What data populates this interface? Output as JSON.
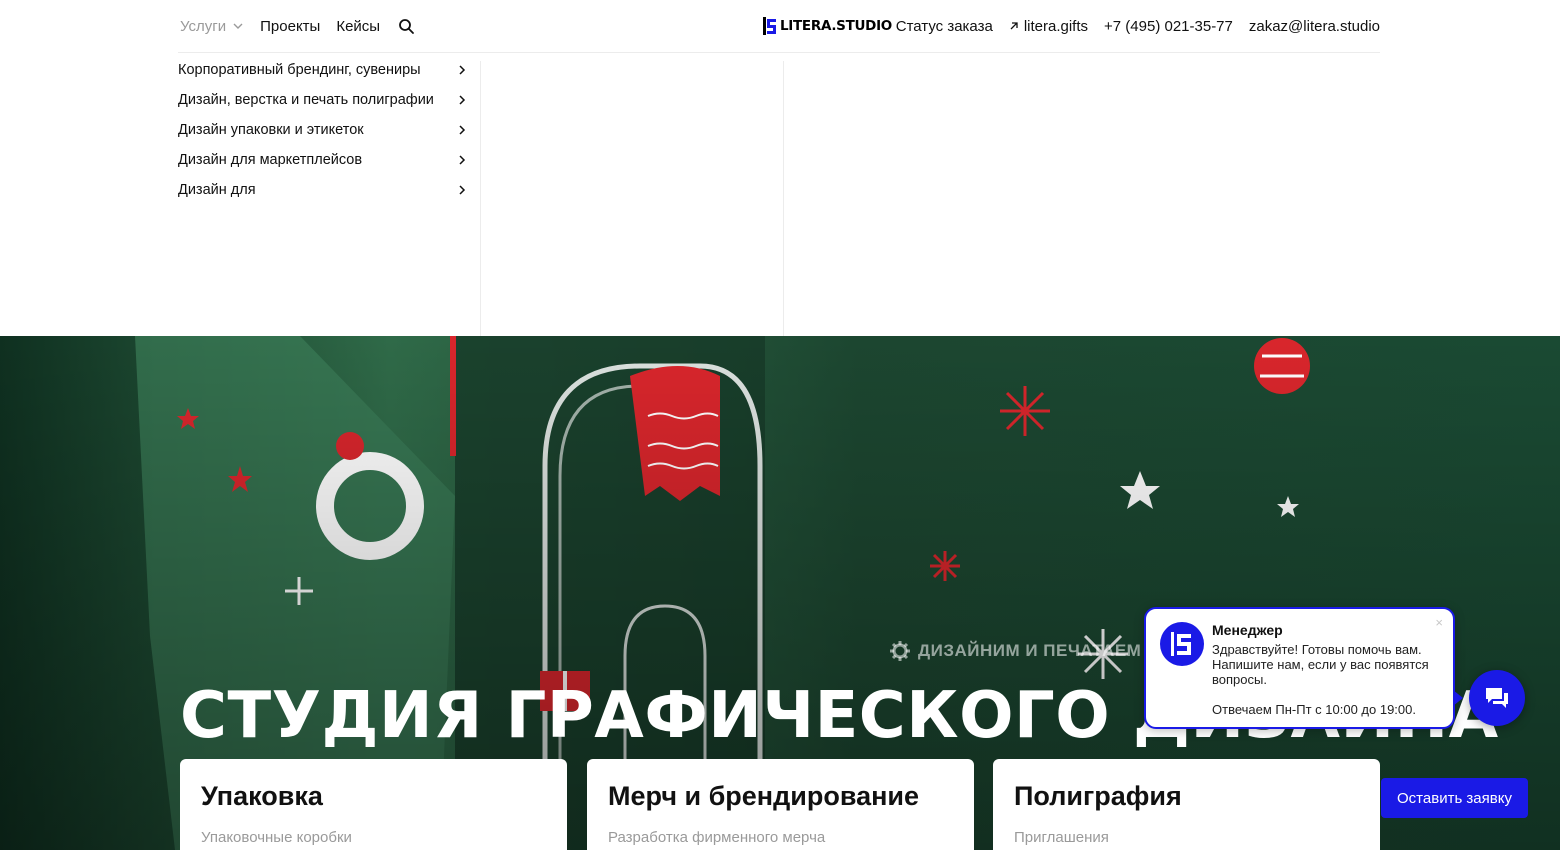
{
  "header": {
    "services_label": "Услуги",
    "projects_label": "Проекты",
    "cases_label": "Кейсы",
    "logo_text": "LITERA.STUDIO",
    "order_status_label": "Статус заказа",
    "gifts_link": "litera.gifts",
    "phone": "+7 (495) 021-35-77",
    "email": "zakaz@litera.studio"
  },
  "services_menu": {
    "items": [
      {
        "label": "Корпоративный брендинг, сувениры"
      },
      {
        "label": "Дизайн, верстка и печать полиграфии"
      },
      {
        "label": "Дизайн упаковки и этикеток"
      },
      {
        "label": "Дизайн для маркетплейсов"
      },
      {
        "label": "Дизайн для"
      }
    ]
  },
  "hero": {
    "tagline": "ДИЗАЙНИМ И ПЕЧАТАЕМ НА",
    "title": "СТУДИЯ ГРАФИЧЕСКОГО ДИЗАЙНА",
    "cards": [
      {
        "title": "Упаковка",
        "subtitle": "Упаковочные коробки"
      },
      {
        "title": "Мерч и брендирование",
        "subtitle": "Разработка фирменного мерча"
      },
      {
        "title": "Полиграфия",
        "subtitle": "Приглашения"
      }
    ]
  },
  "chat": {
    "manager_name": "Менеджер",
    "message": "Здравствуйте! Готовы помочь вам. Напишите нам, если у вас появятся вопросы.",
    "hours": "Отвечаем Пн-Пт с 10:00 до 19:00.",
    "close_symbol": "×"
  },
  "cta": {
    "label": "Оставить заявку"
  },
  "colors": {
    "accent": "#1a1ae6",
    "hero_green": "#1e4a32",
    "muted_text": "#9a9a9a"
  },
  "icons": {
    "search": "search-icon",
    "chevron_down": "chevron-down-icon",
    "chevron_right": "chevron-right-icon",
    "external": "external-link-arrow-icon",
    "gear": "gear-icon",
    "chat": "chat-icon"
  }
}
